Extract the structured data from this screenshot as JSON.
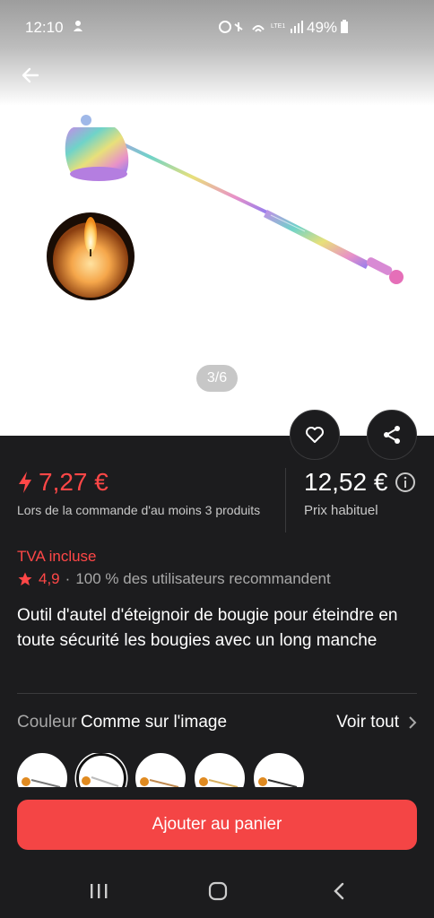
{
  "status_bar": {
    "time": "12:10",
    "battery_pct": "49%",
    "network_label": "LTE1"
  },
  "gallery": {
    "pager": "3/6"
  },
  "price": {
    "sale_price": "7,27 €",
    "sale_note": "Lors de la commande d'au moins 3 produits",
    "regular_price": "12,52 €",
    "regular_label": "Prix habituel"
  },
  "vat_label": "TVA incluse",
  "rating": {
    "value": "4,9",
    "separator": "·",
    "recommend_text": "100 % des utilisateurs recommandent"
  },
  "product_title": "Outil d'autel d'éteignoir de bougie pour éteindre en toute sécurité les bougies avec un long manche",
  "color": {
    "label": "Couleur",
    "value": "Comme sur l'image",
    "see_all": "Voir tout"
  },
  "cart_button": "Ajouter au panier",
  "colors": {
    "accent": "#ff4747",
    "button": "#f44545",
    "background": "#1c1c1e"
  }
}
